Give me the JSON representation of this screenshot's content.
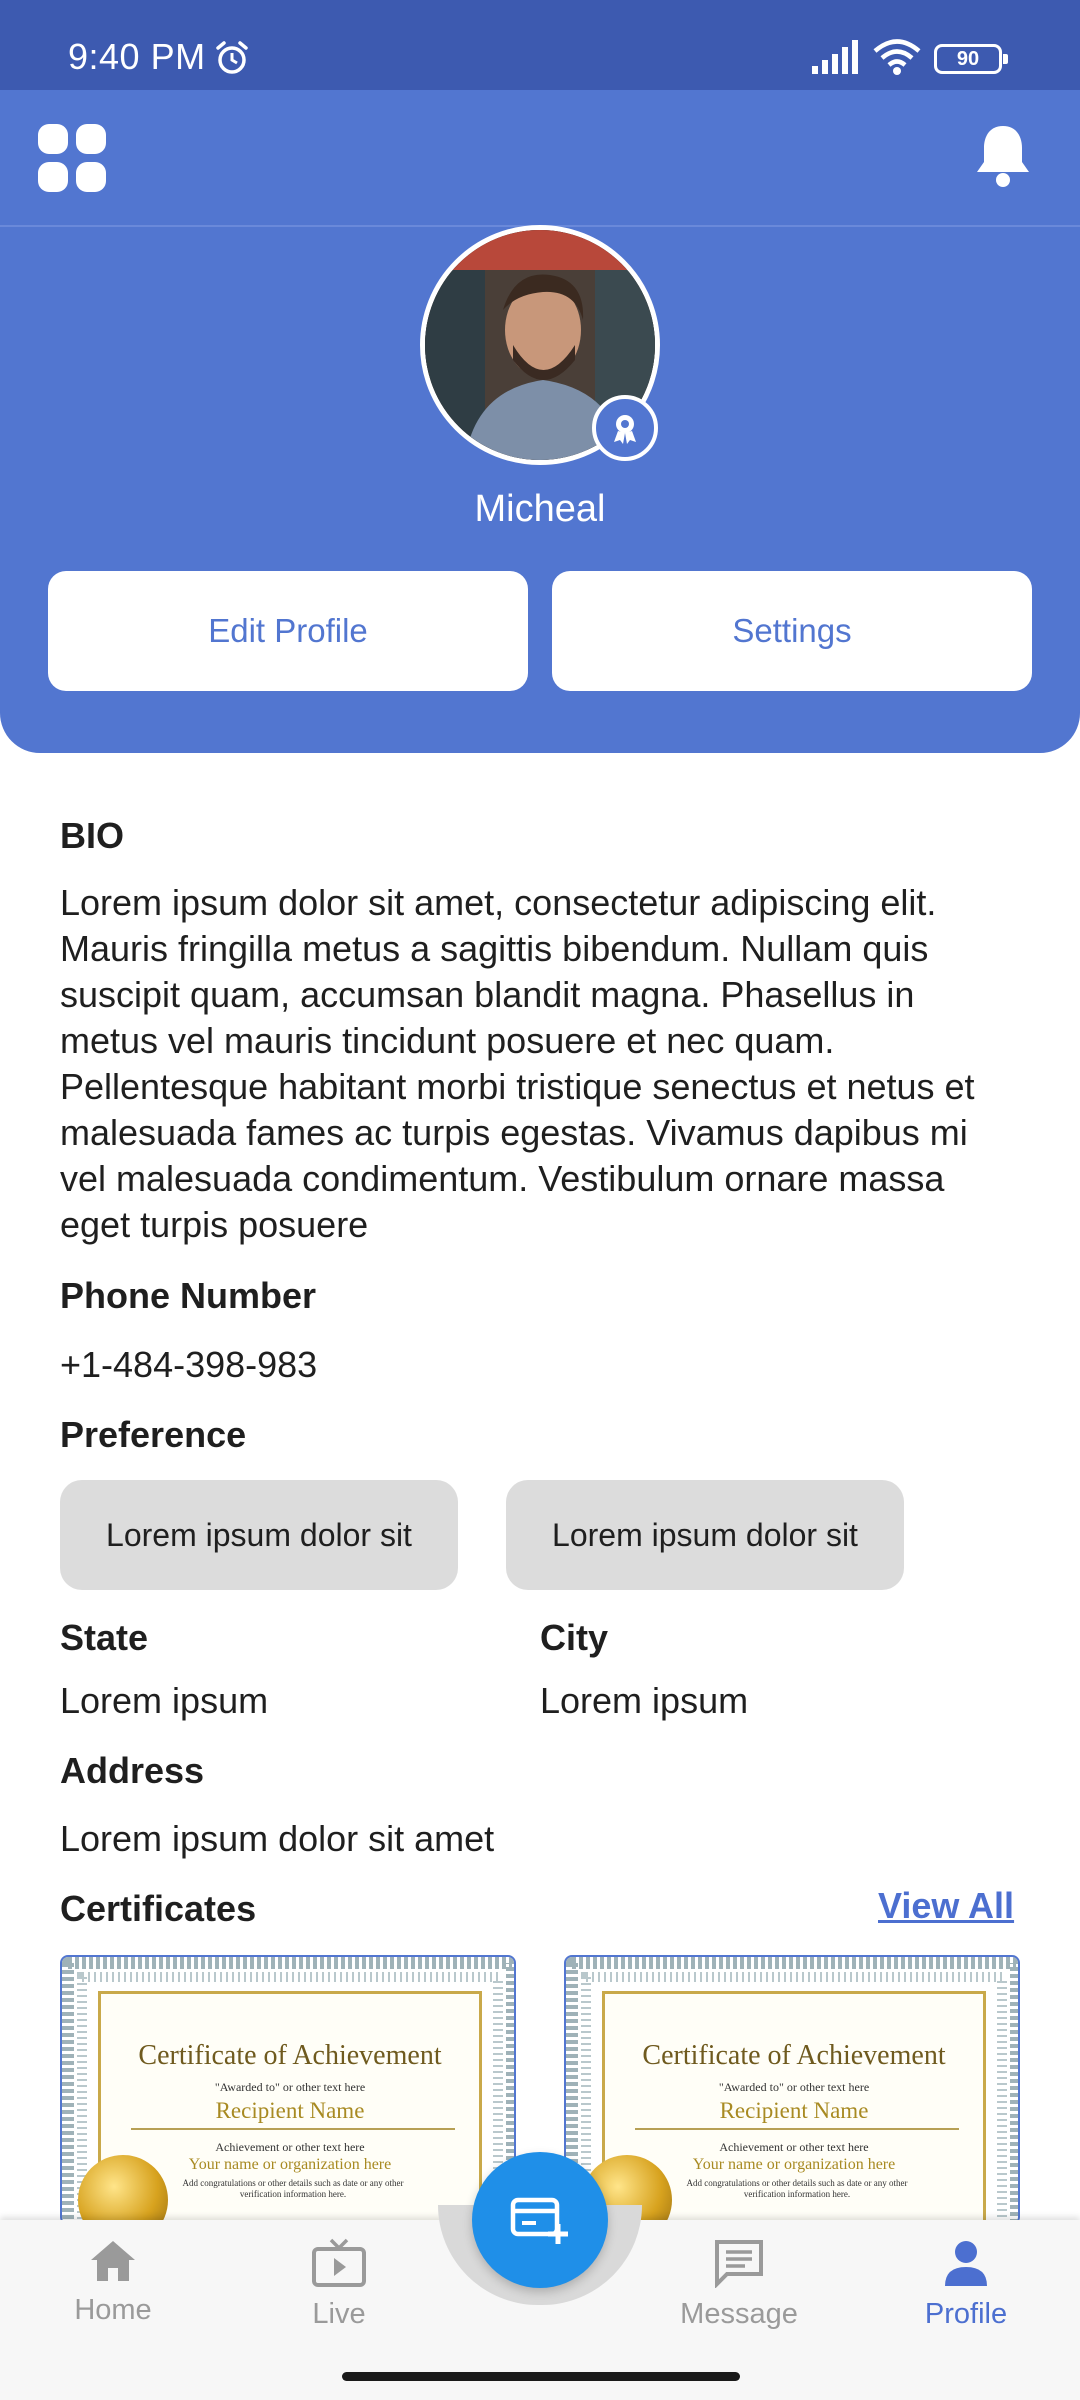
{
  "status_bar": {
    "time": "9:40 PM",
    "battery": "90"
  },
  "profile": {
    "name": "Micheal",
    "edit_label": "Edit Profile",
    "settings_label": "Settings"
  },
  "bio": {
    "heading": "BIO",
    "text": "Lorem ipsum dolor sit amet, consectetur adipiscing elit. Mauris fringilla metus a sagittis bibendum. Nullam quis suscipit quam, accumsan blandit magna. Phasellus in metus vel mauris tincidunt posuere et nec quam. Pellentesque habitant morbi tristique senectus et netus et malesuada fames ac turpis egestas. Vivamus dapibus mi vel malesuada condimentum. Vestibulum ornare massa eget turpis posuere"
  },
  "phone": {
    "heading": "Phone Number",
    "value": "+1-484-398-983"
  },
  "preference": {
    "heading": "Preference",
    "chips": [
      "Lorem ipsum dolor sit",
      "Lorem ipsum dolor sit"
    ]
  },
  "state": {
    "heading": "State",
    "value": "Lorem ipsum"
  },
  "city": {
    "heading": "City",
    "value": "Lorem ipsum"
  },
  "address": {
    "heading": "Address",
    "value": "Lorem ipsum dolor sit amet"
  },
  "certificates": {
    "heading": "Certificates",
    "view_all": "View All",
    "items": [
      {
        "title": "Certificate of Achievement",
        "awarded": "\"Awarded to\" or other text here",
        "recipient": "Recipient Name",
        "achievement": "Achievement or other text here",
        "organization": "Your name or organization here",
        "details": "Add congratulations or other details such as date or any other verification information here."
      },
      {
        "title": "Certificate of Achievement",
        "awarded": "\"Awarded to\" or other text here",
        "recipient": "Recipient Name",
        "achievement": "Achievement or other text here",
        "organization": "Your name or organization here",
        "details": "Add congratulations or other details such as date or any other verification information here."
      }
    ]
  },
  "nav": {
    "home": "Home",
    "live": "Live",
    "message": "Message",
    "profile": "Profile",
    "active": "Profile"
  },
  "colors": {
    "header": "#5276d0",
    "status_bar": "#3d5ab0",
    "accent": "#4c6fd0",
    "fab": "#1f8fe8",
    "chip": "#dcdcdc"
  }
}
